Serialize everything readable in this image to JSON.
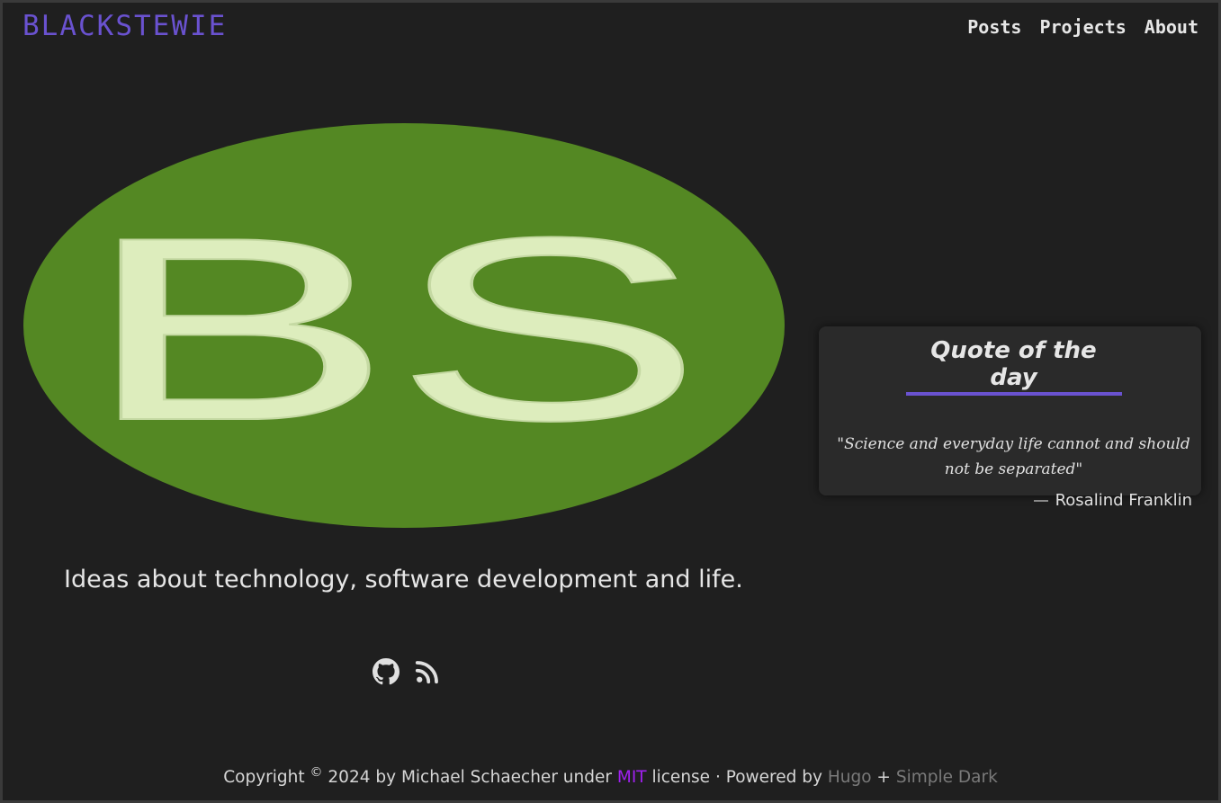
{
  "header": {
    "brand": "BLACKSTEWIE",
    "nav": [
      "Posts",
      "Projects",
      "About"
    ]
  },
  "logo": {
    "text": "BS",
    "fill": "#548823",
    "letter_color": "#ddedbd"
  },
  "quote": {
    "title": "Quote of the day",
    "text": "\"Science and everyday life cannot and should not be separated\"",
    "author": "Rosalind Franklin"
  },
  "tagline": "Ideas about technology, software development and life.",
  "social": {
    "icons": [
      "github-icon",
      "rss-icon"
    ]
  },
  "footer": {
    "copyright_prefix": "Copyright",
    "copyright_symbol": "©",
    "copyright_text": "2024 by Michael Schaecher under",
    "license": "MIT",
    "license_suffix": "license · Powered by",
    "hugo": "Hugo",
    "plus": "+",
    "theme": "Simple Dark"
  },
  "colors": {
    "accent": "#6a52d0",
    "background": "#1f1f1f",
    "link_mit": "#a020f0"
  }
}
